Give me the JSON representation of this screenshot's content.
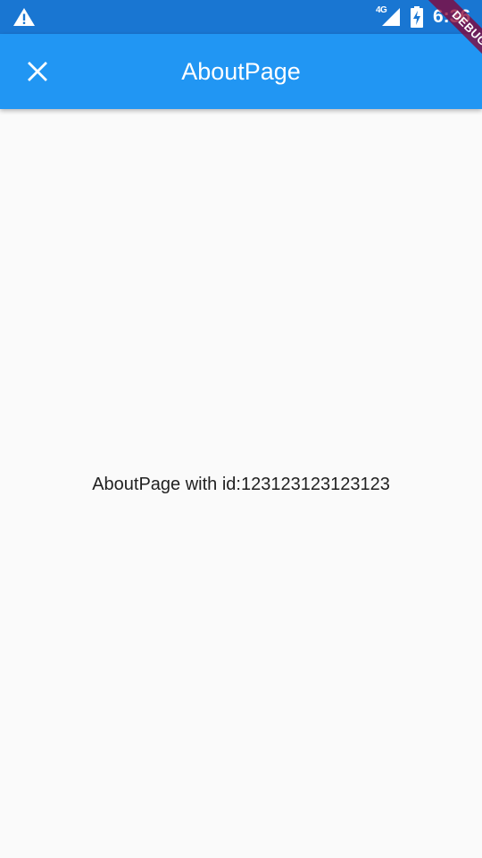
{
  "status_bar": {
    "network": "4G",
    "time": "6:36",
    "icons": [
      "warning-icon",
      "signal-icon",
      "battery-charging-icon"
    ]
  },
  "app_bar": {
    "title": "AboutPage",
    "leading_icon": "close-icon"
  },
  "content": {
    "text": "AboutPage with id:123123123123123"
  },
  "debug_banner": {
    "label": "DEBUG"
  },
  "colors": {
    "status_bar": "#1976d2",
    "app_bar": "#2196f3",
    "background": "#fafafa",
    "text": "#212121",
    "debug_banner": "#880032"
  }
}
